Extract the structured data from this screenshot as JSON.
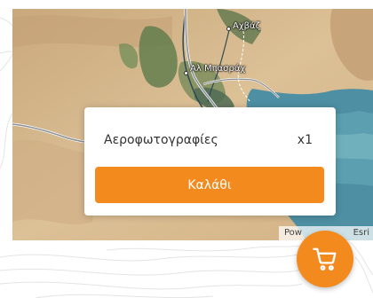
{
  "map": {
    "places": [
      {
        "name": "Αχβάζ"
      },
      {
        "name": "Αλ Μπασράχ"
      }
    ],
    "attribution": {
      "left": "Pow",
      "right": "Esri"
    }
  },
  "cart_popup": {
    "item_label": "Αεροφωτογραφίες",
    "item_count": "x1",
    "button_label": "Καλάθι"
  },
  "cart_fab": {
    "icon": "shopping-cart-icon"
  },
  "colors": {
    "accent": "#f38a1e",
    "map_desert": "#d8b98e",
    "map_water": "#4e8fa3",
    "vegetation": "#5d7a4a"
  }
}
